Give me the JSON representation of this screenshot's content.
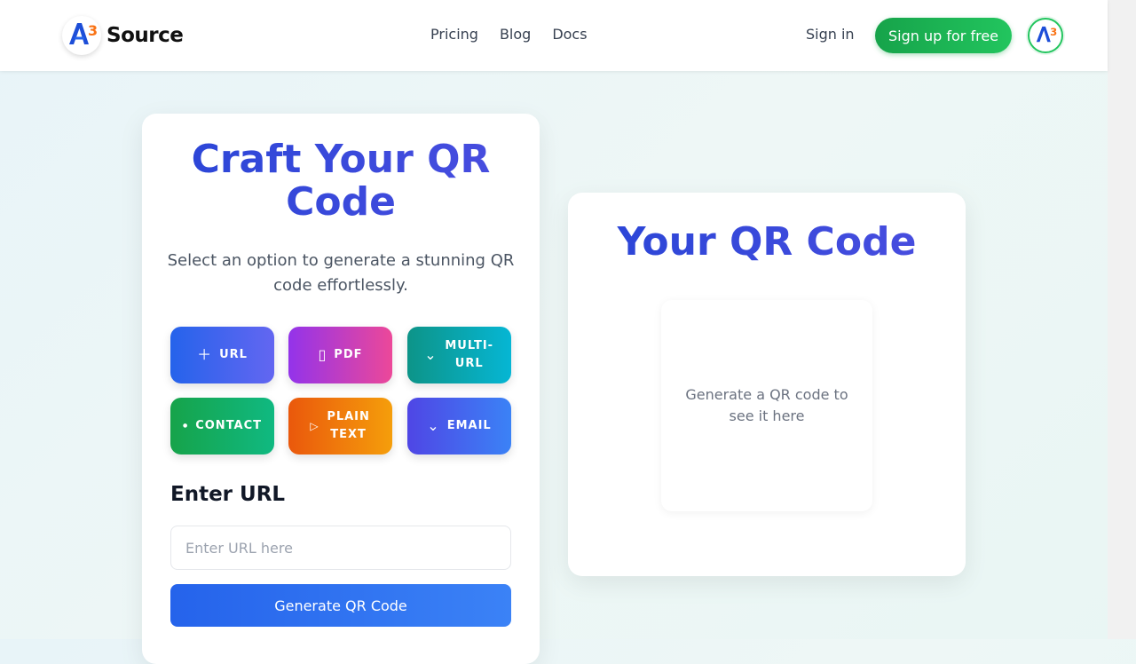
{
  "header": {
    "logo_text": "Source",
    "nav": [
      "Pricing",
      "Blog",
      "Docs"
    ],
    "sign_in": "Sign in",
    "sign_up": "Sign up for free"
  },
  "generator": {
    "title": "Craft Your QR Code",
    "subtitle": "Select an option to generate a stunning QR code effortlessly.",
    "options": [
      {
        "label": "URL",
        "icon": "plus-icon"
      },
      {
        "label": "PDF",
        "icon": "file-icon"
      },
      {
        "label": "MULTI-URL",
        "icon": "chevron-down-icon"
      },
      {
        "label": "CONTACT",
        "icon": "dot-icon"
      },
      {
        "label": "PLAIN TEXT",
        "icon": "play-icon"
      },
      {
        "label": "EMAIL",
        "icon": "chevron-down-icon"
      }
    ],
    "input_label": "Enter URL",
    "input_placeholder": "Enter URL here",
    "input_value": "",
    "generate_label": "Generate QR Code"
  },
  "preview": {
    "title": "Your QR Code",
    "empty_hint": "Generate a QR code to see it here"
  },
  "colors": {
    "accent": "#3b3fd8",
    "sign_up_green": "#16a34a"
  }
}
